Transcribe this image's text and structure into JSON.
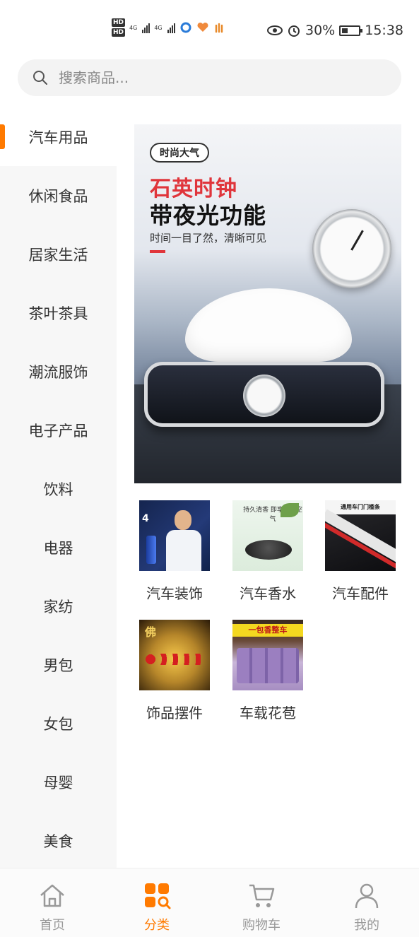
{
  "status_bar": {
    "left_badges": [
      "HD",
      "HD"
    ],
    "signal1_label": "4G",
    "signal2_label": "4G",
    "battery_percent": "30%",
    "time": "15:38",
    "icons": [
      "eye-icon",
      "alarm-icon",
      "battery-icon"
    ]
  },
  "search": {
    "placeholder": "搜索商品..."
  },
  "sidebar": {
    "items": [
      {
        "label": "汽车用品",
        "active": true
      },
      {
        "label": "休闲食品"
      },
      {
        "label": "居家生活"
      },
      {
        "label": "茶叶茶具"
      },
      {
        "label": "潮流服饰"
      },
      {
        "label": "电子产品"
      },
      {
        "label": "饮料"
      },
      {
        "label": "电器"
      },
      {
        "label": "家纺"
      },
      {
        "label": "男包"
      },
      {
        "label": "女包"
      },
      {
        "label": "母婴"
      },
      {
        "label": "美食"
      }
    ]
  },
  "banner": {
    "tag": "时尚大气",
    "title_line1": "石英时钟",
    "title_line2": "带夜光功能",
    "subtitle": "时间一目了然，清晰可见"
  },
  "categories": [
    {
      "label": "汽车装饰",
      "thumb_text": "4"
    },
    {
      "label": "汽车香水",
      "thumb_text": "持久清香 即享清新空气"
    },
    {
      "label": "汽车配件",
      "thumb_text": "通用车门门槛条"
    },
    {
      "label": "饰品摆件",
      "thumb_text": "佛"
    },
    {
      "label": "车载花苞",
      "thumb_text": "一包香整车"
    }
  ],
  "tabbar": {
    "tabs": [
      {
        "label": "首页",
        "icon": "home-icon"
      },
      {
        "label": "分类",
        "icon": "category-icon",
        "active": true
      },
      {
        "label": "购物车",
        "icon": "cart-icon"
      },
      {
        "label": "我的",
        "icon": "user-icon"
      }
    ]
  },
  "colors": {
    "accent": "#ff7a00",
    "sidebar_bg": "#f7f7f7",
    "text": "#333333",
    "muted": "#999999"
  }
}
